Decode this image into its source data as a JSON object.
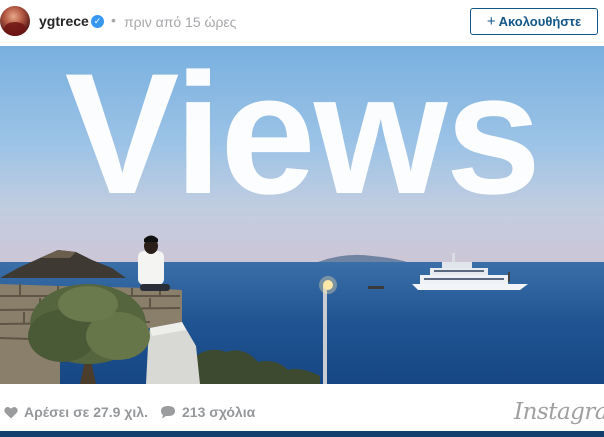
{
  "post": {
    "username": "ygtrece",
    "separator": "•",
    "timestamp": "πριν από 15 ώρες",
    "follow_label": "Ακολουθήστε",
    "follow_icon": "plus-icon",
    "verified_icon": "verified-badge-icon",
    "verified_glyph": "✓"
  },
  "photo": {
    "overlay_text": "Views"
  },
  "footer": {
    "likes_label": "Αρέσει σε 27.9 χιλ.",
    "likes_icon": "heart-icon",
    "comments_label": "213 σχόλια",
    "comments_icon": "comment-bubble-icon",
    "brand": "Instagram"
  },
  "colors": {
    "follow_accent": "#125688",
    "verified_blue": "#3897f0",
    "muted_text": "#95989a",
    "bottom_bar": "#133f6e"
  }
}
